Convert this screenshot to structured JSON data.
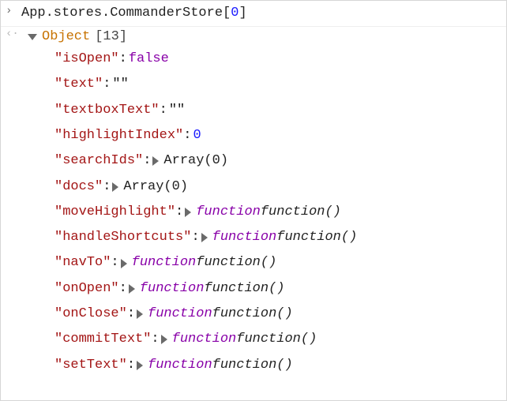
{
  "input": {
    "prompt_icon": "›",
    "return_icon": "‹·",
    "text_prefix": "App.stores.CommanderStore[",
    "index": "0",
    "text_suffix": "]"
  },
  "result": {
    "type_label": "Object",
    "count_open": "[",
    "count": "13",
    "count_close": "]",
    "props": [
      {
        "key": "isOpen",
        "kind": "bool",
        "value": "false"
      },
      {
        "key": "text",
        "kind": "str",
        "value": "\"\""
      },
      {
        "key": "textboxText",
        "kind": "str",
        "value": "\"\""
      },
      {
        "key": "highlightIndex",
        "kind": "num",
        "value": "0"
      },
      {
        "key": "searchIds",
        "kind": "arr",
        "value": "Array(0)"
      },
      {
        "key": "docs",
        "kind": "arr",
        "value": "Array(0)"
      },
      {
        "key": "moveHighlight",
        "kind": "fn",
        "kw": "function",
        "sig": "function()"
      },
      {
        "key": "handleShortcuts",
        "kind": "fn",
        "kw": "function",
        "sig": "function()"
      },
      {
        "key": "navTo",
        "kind": "fn",
        "kw": "function",
        "sig": "function()"
      },
      {
        "key": "onOpen",
        "kind": "fn",
        "kw": "function",
        "sig": "function()"
      },
      {
        "key": "onClose",
        "kind": "fn",
        "kw": "function",
        "sig": "function()"
      },
      {
        "key": "commitText",
        "kind": "fn",
        "kw": "function",
        "sig": "function()"
      },
      {
        "key": "setText",
        "kind": "fn",
        "kw": "function",
        "sig": "function()"
      }
    ]
  }
}
